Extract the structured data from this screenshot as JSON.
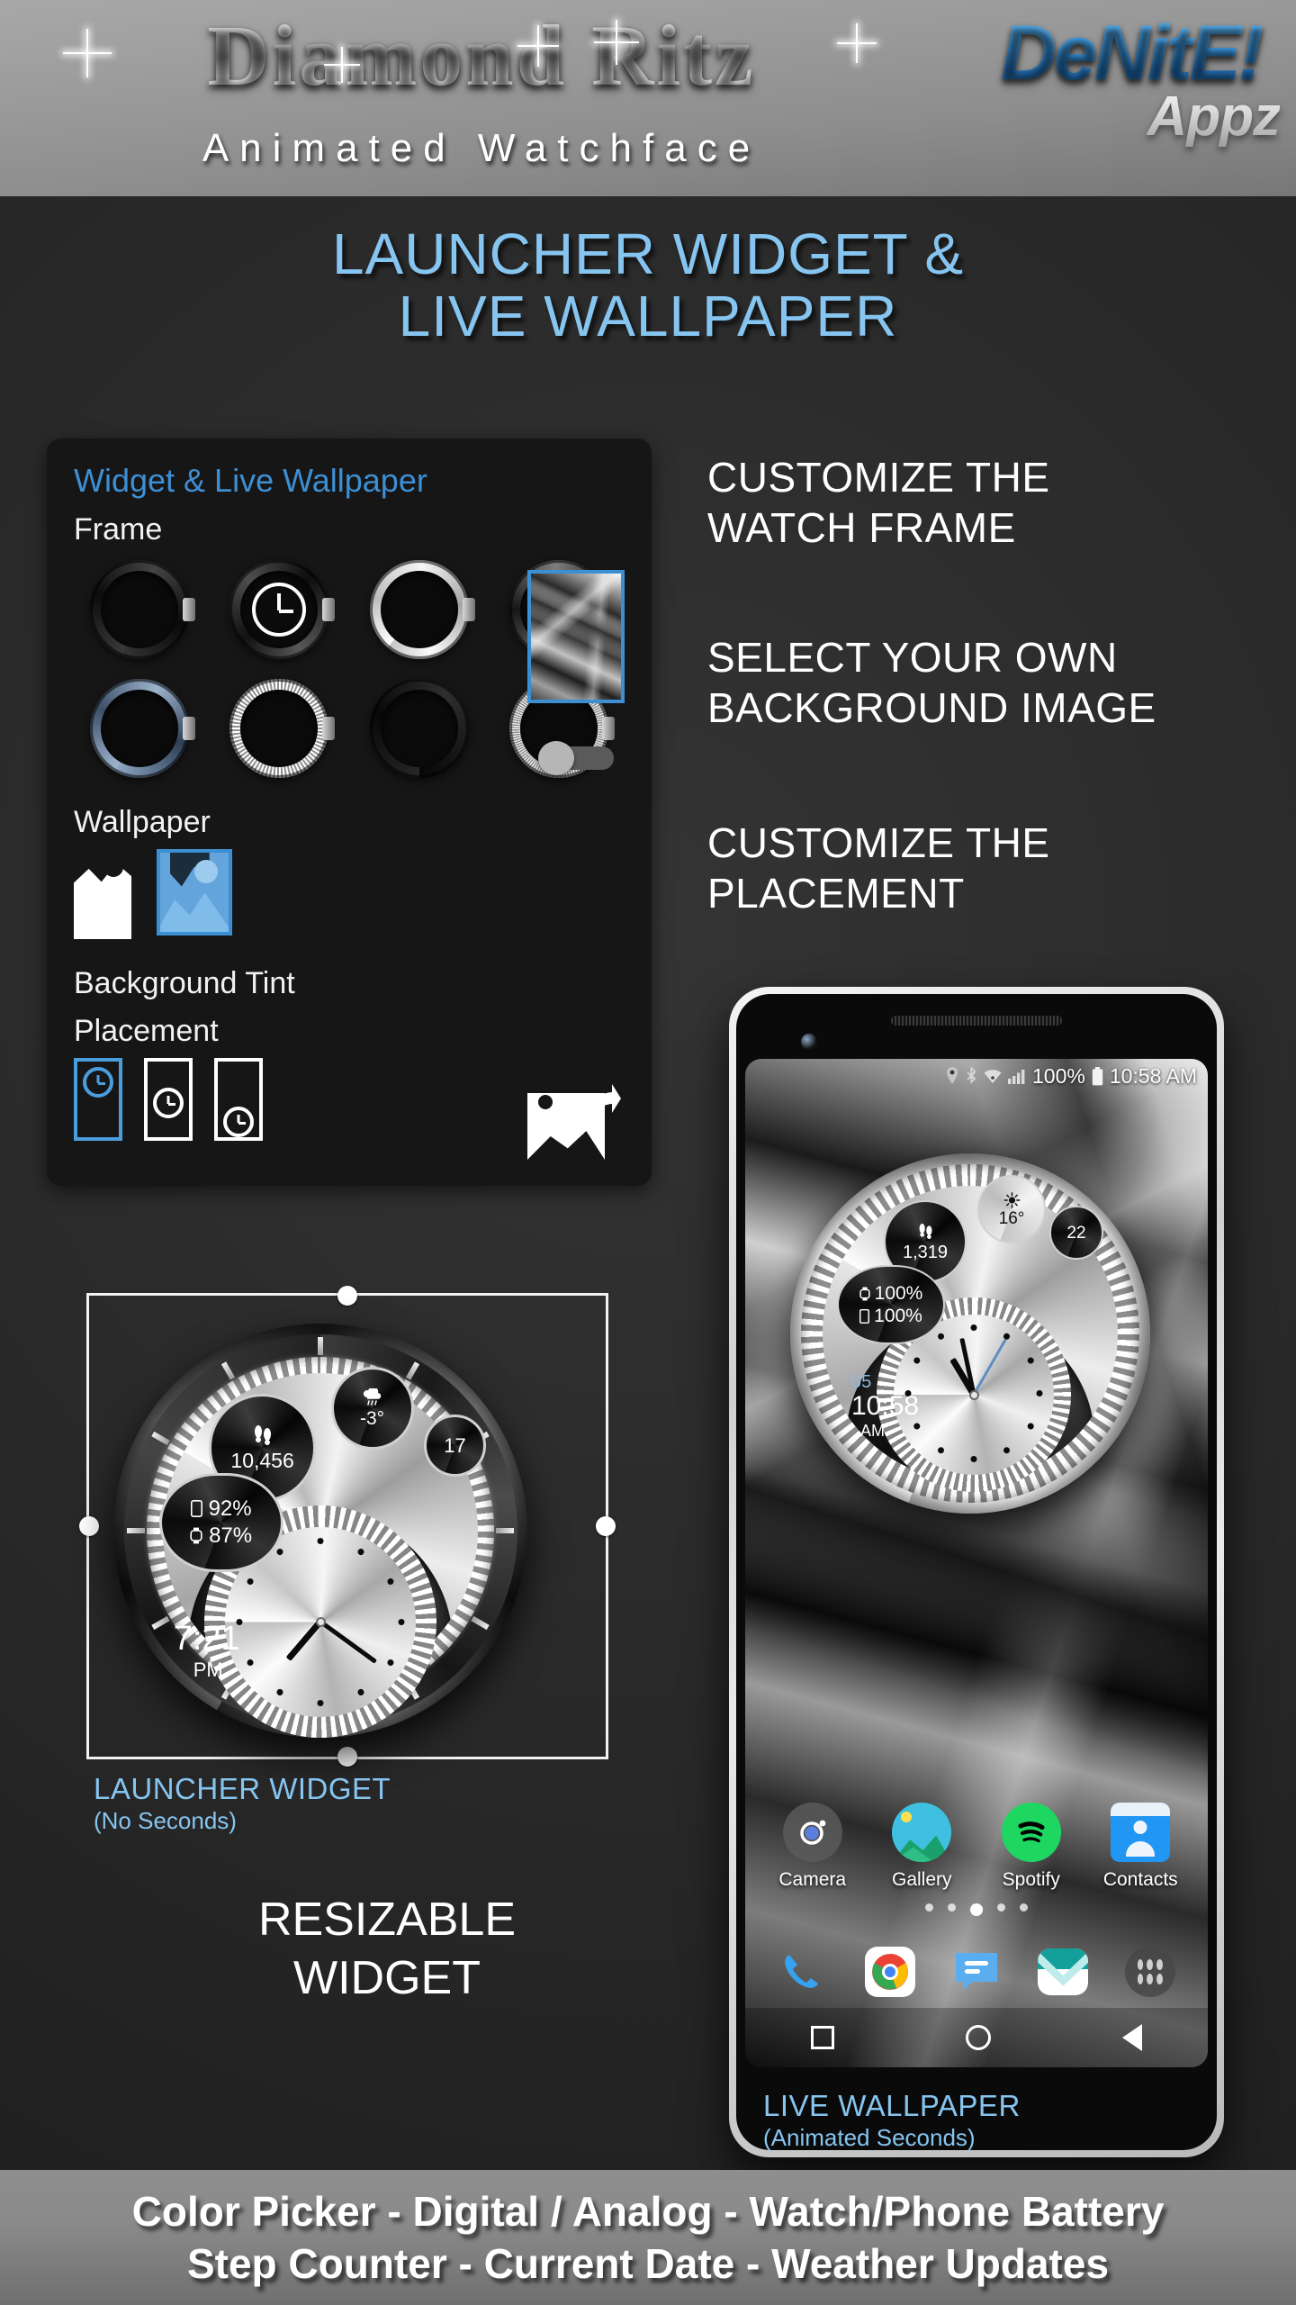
{
  "header": {
    "brand_title": "Diamond Ritz",
    "brand_subtitle": "Animated Watchface",
    "logo_main": "DeNitE!",
    "logo_sub": "Appz"
  },
  "main_heading": "LAUNCHER WIDGET &\nLIVE WALLPAPER",
  "settings_panel": {
    "title": "Widget & Live Wallpaper",
    "frame_label": "Frame",
    "wallpaper_label": "Wallpaper",
    "background_tint_label": "Background Tint",
    "placement_label": "Placement",
    "frames": [
      {
        "name": "frame-black-matte",
        "selected": false
      },
      {
        "name": "frame-black-clock",
        "selected": true
      },
      {
        "name": "frame-silver-polished",
        "selected": false
      },
      {
        "name": "frame-gunmetal",
        "selected": false
      },
      {
        "name": "frame-blue-steel",
        "selected": false
      },
      {
        "name": "frame-diamond-silver",
        "selected": false
      },
      {
        "name": "frame-plain-black",
        "selected": false
      },
      {
        "name": "frame-knurled-silver",
        "selected": false
      }
    ],
    "wallpaper_options": [
      {
        "name": "wallpaper-none",
        "selected": false
      },
      {
        "name": "wallpaper-image",
        "selected": true
      }
    ],
    "background_tint_on": false,
    "placement_options": [
      {
        "name": "placement-top",
        "selected": true
      },
      {
        "name": "placement-middle",
        "selected": false
      },
      {
        "name": "placement-bottom",
        "selected": false
      }
    ],
    "pick_image_icon": "pick-image-icon",
    "preview_icon": "wallpaper-preview"
  },
  "features": [
    "CUSTOMIZE THE\nWATCH FRAME",
    "SELECT YOUR OWN\nBACKGROUND IMAGE",
    "CUSTOMIZE THE\nPLACEMENT"
  ],
  "launcher_widget": {
    "caption_main": "LAUNCHER WIDGET",
    "caption_sub": "(No Seconds)",
    "resizable_text": "RESIZABLE\nWIDGET",
    "watch": {
      "steps": "10,456",
      "steps_icon": "footsteps-icon",
      "weather_temp": "-3°",
      "weather_icon": "rain-cloud-icon",
      "date": "17",
      "phone_battery": "92%",
      "phone_icon": "phone-icon",
      "watch_battery": "87%",
      "watch_icon": "watch-icon",
      "digital_time": "7:21",
      "digital_ampm": "PM",
      "analog_hour": 7,
      "analog_minute": 21
    }
  },
  "phone": {
    "status_bar": {
      "battery_percent": "100%",
      "time": "10:58 AM",
      "icons": [
        "location-icon",
        "bluetooth-icon",
        "wifi-icon",
        "signal-icon",
        "battery-icon"
      ]
    },
    "watch": {
      "steps": "1,319",
      "steps_icon": "footsteps-icon",
      "weather_temp": "16°",
      "weather_icon": "sun-icon",
      "date": "22",
      "watch_battery": "100%",
      "watch_icon": "watch-icon",
      "phone_battery": "100%",
      "phone_icon": "phone-icon",
      "digital_seconds": "05",
      "digital_time": "10:58",
      "digital_ampm": "AM",
      "analog_hour": 10,
      "analog_minute": 58
    },
    "apps": [
      {
        "label": "Camera",
        "icon": "camera-icon"
      },
      {
        "label": "Gallery",
        "icon": "gallery-icon"
      },
      {
        "label": "Spotify",
        "icon": "spotify-icon"
      },
      {
        "label": "Contacts",
        "icon": "contacts-icon"
      }
    ],
    "page_dots": 5,
    "active_dot": 3,
    "dock": [
      {
        "name": "phone-dialer-icon"
      },
      {
        "name": "chrome-icon"
      },
      {
        "name": "messages-icon"
      },
      {
        "name": "email-icon"
      },
      {
        "name": "app-drawer-icon"
      }
    ],
    "nav": [
      "recents-square-icon",
      "home-circle-icon",
      "back-triangle-icon"
    ],
    "caption_main": "LIVE WALLPAPER",
    "caption_sub": "(Animated Seconds)"
  },
  "bottom_bar": {
    "line1": "Color Picker - Digital / Analog - Watch/Phone Battery",
    "line2": "Step Counter - Current Date - Weather Updates"
  },
  "colors": {
    "accent_blue": "#86c5f0",
    "panel_blue": "#3d8fd4",
    "bg": "#232323"
  }
}
